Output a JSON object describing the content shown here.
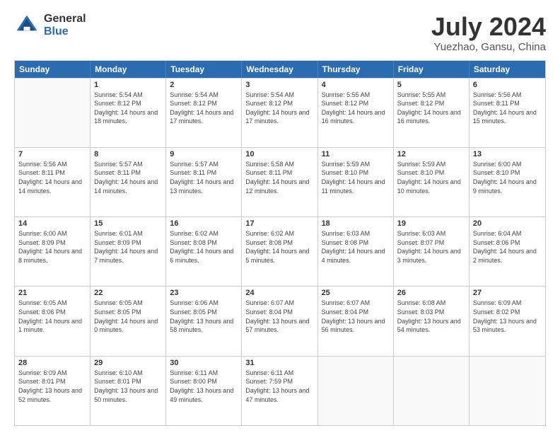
{
  "header": {
    "logo_general": "General",
    "logo_blue": "Blue",
    "title": "July 2024",
    "subtitle": "Yuezhao, Gansu, China"
  },
  "days_of_week": [
    "Sunday",
    "Monday",
    "Tuesday",
    "Wednesday",
    "Thursday",
    "Friday",
    "Saturday"
  ],
  "weeks": [
    [
      {
        "day": "",
        "empty": true
      },
      {
        "day": "1",
        "sunrise": "5:54 AM",
        "sunset": "8:12 PM",
        "daylight": "14 hours and 18 minutes."
      },
      {
        "day": "2",
        "sunrise": "5:54 AM",
        "sunset": "8:12 PM",
        "daylight": "14 hours and 17 minutes."
      },
      {
        "day": "3",
        "sunrise": "5:54 AM",
        "sunset": "8:12 PM",
        "daylight": "14 hours and 17 minutes."
      },
      {
        "day": "4",
        "sunrise": "5:55 AM",
        "sunset": "8:12 PM",
        "daylight": "14 hours and 16 minutes."
      },
      {
        "day": "5",
        "sunrise": "5:55 AM",
        "sunset": "8:12 PM",
        "daylight": "14 hours and 16 minutes."
      },
      {
        "day": "6",
        "sunrise": "5:56 AM",
        "sunset": "8:11 PM",
        "daylight": "14 hours and 15 minutes."
      }
    ],
    [
      {
        "day": "7",
        "sunrise": "5:56 AM",
        "sunset": "8:11 PM",
        "daylight": "14 hours and 14 minutes."
      },
      {
        "day": "8",
        "sunrise": "5:57 AM",
        "sunset": "8:11 PM",
        "daylight": "14 hours and 14 minutes."
      },
      {
        "day": "9",
        "sunrise": "5:57 AM",
        "sunset": "8:11 PM",
        "daylight": "14 hours and 13 minutes."
      },
      {
        "day": "10",
        "sunrise": "5:58 AM",
        "sunset": "8:11 PM",
        "daylight": "14 hours and 12 minutes."
      },
      {
        "day": "11",
        "sunrise": "5:59 AM",
        "sunset": "8:10 PM",
        "daylight": "14 hours and 11 minutes."
      },
      {
        "day": "12",
        "sunrise": "5:59 AM",
        "sunset": "8:10 PM",
        "daylight": "14 hours and 10 minutes."
      },
      {
        "day": "13",
        "sunrise": "6:00 AM",
        "sunset": "8:10 PM",
        "daylight": "14 hours and 9 minutes."
      }
    ],
    [
      {
        "day": "14",
        "sunrise": "6:00 AM",
        "sunset": "8:09 PM",
        "daylight": "14 hours and 8 minutes."
      },
      {
        "day": "15",
        "sunrise": "6:01 AM",
        "sunset": "8:09 PM",
        "daylight": "14 hours and 7 minutes."
      },
      {
        "day": "16",
        "sunrise": "6:02 AM",
        "sunset": "8:08 PM",
        "daylight": "14 hours and 6 minutes."
      },
      {
        "day": "17",
        "sunrise": "6:02 AM",
        "sunset": "8:08 PM",
        "daylight": "14 hours and 5 minutes."
      },
      {
        "day": "18",
        "sunrise": "6:03 AM",
        "sunset": "8:08 PM",
        "daylight": "14 hours and 4 minutes."
      },
      {
        "day": "19",
        "sunrise": "6:03 AM",
        "sunset": "8:07 PM",
        "daylight": "14 hours and 3 minutes."
      },
      {
        "day": "20",
        "sunrise": "6:04 AM",
        "sunset": "8:06 PM",
        "daylight": "14 hours and 2 minutes."
      }
    ],
    [
      {
        "day": "21",
        "sunrise": "6:05 AM",
        "sunset": "8:06 PM",
        "daylight": "14 hours and 1 minute."
      },
      {
        "day": "22",
        "sunrise": "6:05 AM",
        "sunset": "8:05 PM",
        "daylight": "14 hours and 0 minutes."
      },
      {
        "day": "23",
        "sunrise": "6:06 AM",
        "sunset": "8:05 PM",
        "daylight": "13 hours and 58 minutes."
      },
      {
        "day": "24",
        "sunrise": "6:07 AM",
        "sunset": "8:04 PM",
        "daylight": "13 hours and 57 minutes."
      },
      {
        "day": "25",
        "sunrise": "6:07 AM",
        "sunset": "8:04 PM",
        "daylight": "13 hours and 56 minutes."
      },
      {
        "day": "26",
        "sunrise": "6:08 AM",
        "sunset": "8:03 PM",
        "daylight": "13 hours and 54 minutes."
      },
      {
        "day": "27",
        "sunrise": "6:09 AM",
        "sunset": "8:02 PM",
        "daylight": "13 hours and 53 minutes."
      }
    ],
    [
      {
        "day": "28",
        "sunrise": "6:09 AM",
        "sunset": "8:01 PM",
        "daylight": "13 hours and 52 minutes."
      },
      {
        "day": "29",
        "sunrise": "6:10 AM",
        "sunset": "8:01 PM",
        "daylight": "13 hours and 50 minutes."
      },
      {
        "day": "30",
        "sunrise": "6:11 AM",
        "sunset": "8:00 PM",
        "daylight": "13 hours and 49 minutes."
      },
      {
        "day": "31",
        "sunrise": "6:11 AM",
        "sunset": "7:59 PM",
        "daylight": "13 hours and 47 minutes."
      },
      {
        "day": "",
        "empty": true
      },
      {
        "day": "",
        "empty": true
      },
      {
        "day": "",
        "empty": true
      }
    ]
  ]
}
